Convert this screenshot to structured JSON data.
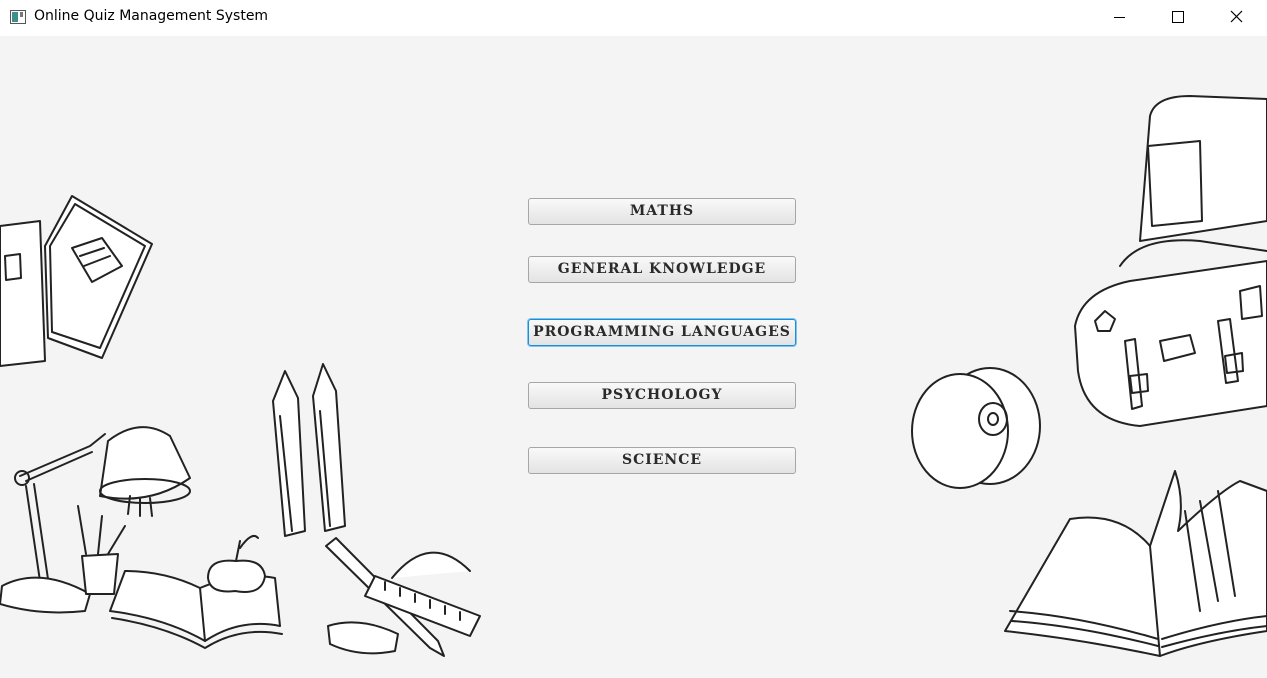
{
  "window": {
    "title": "Online Quiz Management System"
  },
  "icons": {
    "app": "app-window-icon",
    "minimize": "minimize-icon",
    "maximize": "maximize-icon",
    "close": "close-icon"
  },
  "menu": {
    "buttons": [
      {
        "label": "MATHS",
        "focused": false
      },
      {
        "label": "GENERAL KNOWLEDGE",
        "focused": false
      },
      {
        "label": "PROGRAMMING LANGUAGES",
        "focused": true
      },
      {
        "label": "PSYCHOLOGY",
        "focused": false
      },
      {
        "label": "SCIENCE",
        "focused": false
      }
    ]
  },
  "colors": {
    "background": "#f4f4f4",
    "focus_border": "#1c8ed6",
    "button_text": "#2a2a2a"
  }
}
